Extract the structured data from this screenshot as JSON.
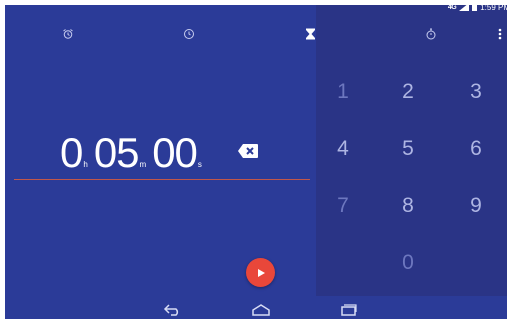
{
  "status_bar": {
    "network": "4G",
    "time": "1:59 PM",
    "icons": [
      "network-type-icon",
      "signal-icon",
      "battery-icon"
    ]
  },
  "tabs": [
    {
      "icon": "alarm-icon",
      "active": false
    },
    {
      "icon": "clock-icon",
      "active": false
    },
    {
      "icon": "timer-hourglass-icon",
      "active": true
    },
    {
      "icon": "stopwatch-icon",
      "active": false
    }
  ],
  "overflow_icon": "more-vert-icon",
  "timer": {
    "hours": "0",
    "hours_unit": "h",
    "minutes": "05",
    "minutes_unit": "m",
    "seconds": "00",
    "seconds_unit": "s"
  },
  "keypad": {
    "keys": [
      "1",
      "2",
      "3",
      "4",
      "5",
      "6",
      "7",
      "8",
      "9",
      "0"
    ]
  },
  "start_button": {
    "icon": "play-icon"
  },
  "nav_bar": {
    "icons": [
      "back-icon",
      "home-icon",
      "recents-icon"
    ]
  },
  "colors": {
    "left_background": "#2b3b98",
    "right_background": "#2a3486",
    "accent": "#e9473a",
    "divider": "#c2574a"
  }
}
